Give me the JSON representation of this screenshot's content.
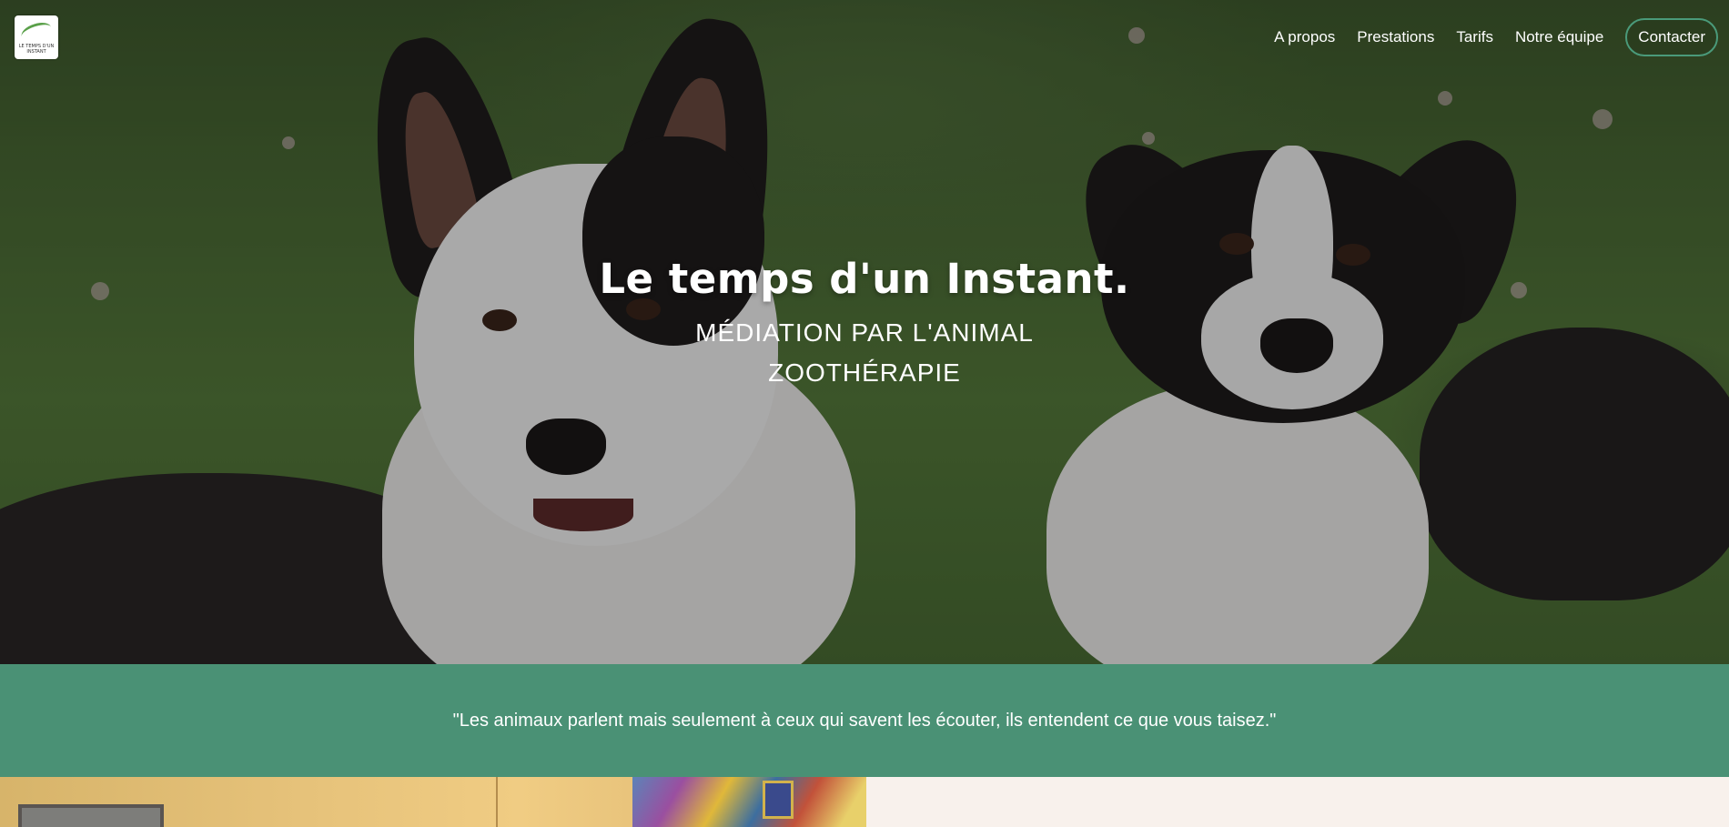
{
  "brand": {
    "logo_alt": "Le temps d'un Instant",
    "logo_caption": "LE TEMPS D'UN INSTANT"
  },
  "nav": {
    "items": [
      {
        "label": "A propos"
      },
      {
        "label": "Prestations"
      },
      {
        "label": "Tarifs"
      },
      {
        "label": "Notre équipe"
      }
    ],
    "cta_label": "Contacter"
  },
  "hero": {
    "title": "Le temps d'un Instant.",
    "subtitle_1": "MÉDIATION PAR L'ANIMAL",
    "subtitle_2": "ZOOTHÉRAPIE"
  },
  "quote": {
    "text": "\"Les animaux parlent mais seulement à ceux qui savent les écouter, ils entendent ce que vous taisez.\""
  },
  "colors": {
    "accent_green": "#4a9175",
    "cta_border": "#4a9a7a",
    "cream": "#f8f1ec"
  },
  "icons": {
    "logo": "brand-logo-icon"
  }
}
